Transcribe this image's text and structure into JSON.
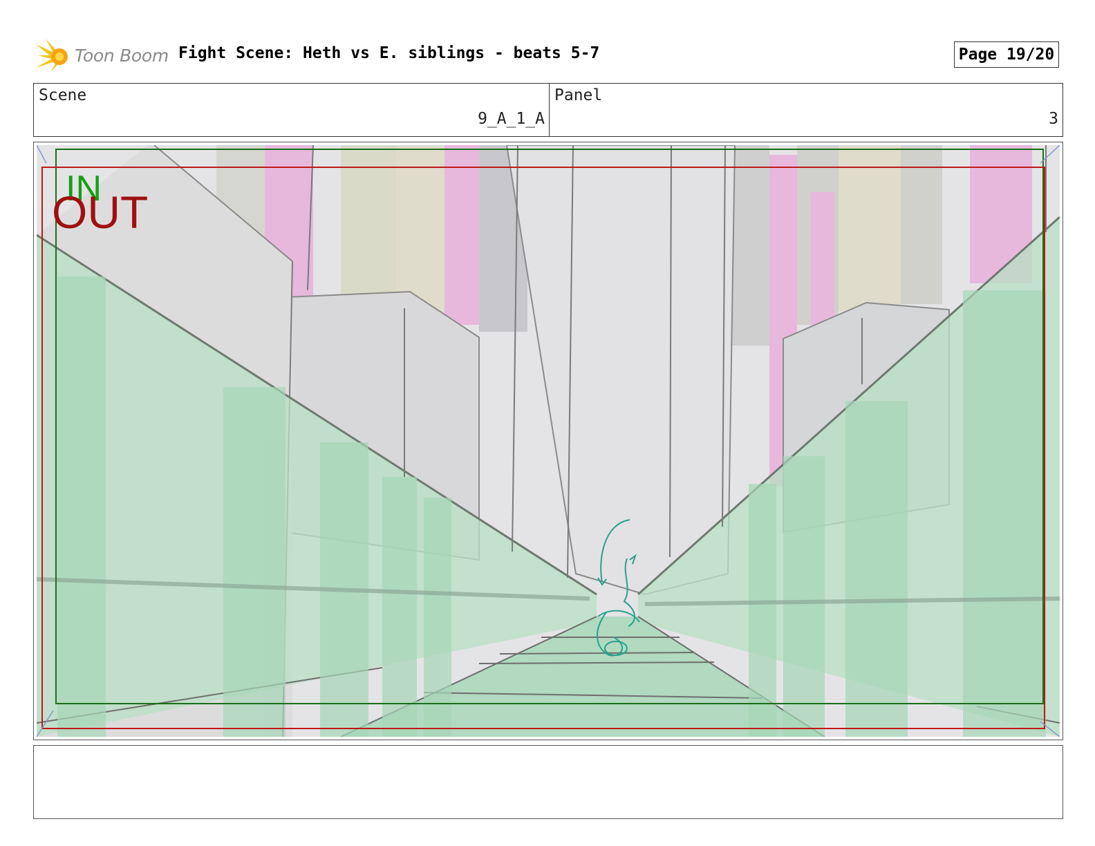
{
  "header": {
    "logo_text": "Toon Boom",
    "title": "Fight Scene: Heth vs E. siblings - beats 5-7",
    "page": "Page 19/20"
  },
  "info": {
    "scene_label": "Scene",
    "scene_value": "9_A_1_A",
    "panel_label": "Panel",
    "panel_value": "3"
  },
  "panel": {
    "in_marker": "IN",
    "out_marker": "OUT",
    "colors": {
      "in_frame": "#1a6e1a",
      "out_frame": "#c01818",
      "in_text": "#12a012",
      "out_text": "#a01010",
      "green_overlay": "#b8e0c4",
      "pink_pillar": "#e8b8dc"
    }
  },
  "notes": {
    "text": ""
  }
}
